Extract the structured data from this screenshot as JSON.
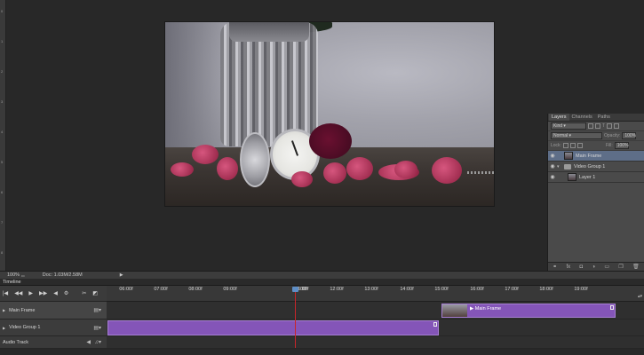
{
  "rulers": {
    "vertical_labels": [
      "0",
      "1",
      "2",
      "3",
      "4",
      "5",
      "6",
      "7",
      "8"
    ]
  },
  "layers_panel": {
    "tabs": [
      {
        "label": "Layers",
        "active": true
      },
      {
        "label": "Channels",
        "active": false
      },
      {
        "label": "Paths",
        "active": false
      }
    ],
    "filter_kind": "Kind",
    "blend_mode": "Normal",
    "opacity_label": "Opacity:",
    "opacity_value": "100%",
    "lock_label": "Lock:",
    "fill_label": "Fill:",
    "fill_value": "100%",
    "layers": [
      {
        "name": "Main Frame",
        "selected": true,
        "type": "video"
      },
      {
        "name": "Video Group 1",
        "selected": false,
        "type": "group"
      },
      {
        "name": "Layer 1",
        "selected": false,
        "type": "layer"
      }
    ],
    "footer_icons": [
      "link-icon",
      "fx-icon",
      "mask-icon",
      "adjustment-icon",
      "folder-icon",
      "new-layer-icon",
      "trash-icon"
    ]
  },
  "status_bar": {
    "zoom": "100%",
    "doc": "Doc: 1.03M/2.58M"
  },
  "timeline": {
    "title": "Timeline",
    "ruler_ticks": [
      "06:00f",
      "07:00f",
      "08:00f",
      "09:00f",
      "10:00f",
      "11:00f",
      "12:00f",
      "13:00f",
      "14:00f",
      "15:00f",
      "16:00f",
      "17:00f",
      "18:00f",
      "19:00f"
    ],
    "tracks": [
      {
        "label": "Main Frame",
        "clip_label": "Main Frame"
      },
      {
        "label": "Video Group 1"
      },
      {
        "label": "Audio Track"
      }
    ],
    "colors": {
      "clip": "#8455b8",
      "playhead": "#c8252a",
      "selected_layer": "#5e6e88"
    }
  }
}
